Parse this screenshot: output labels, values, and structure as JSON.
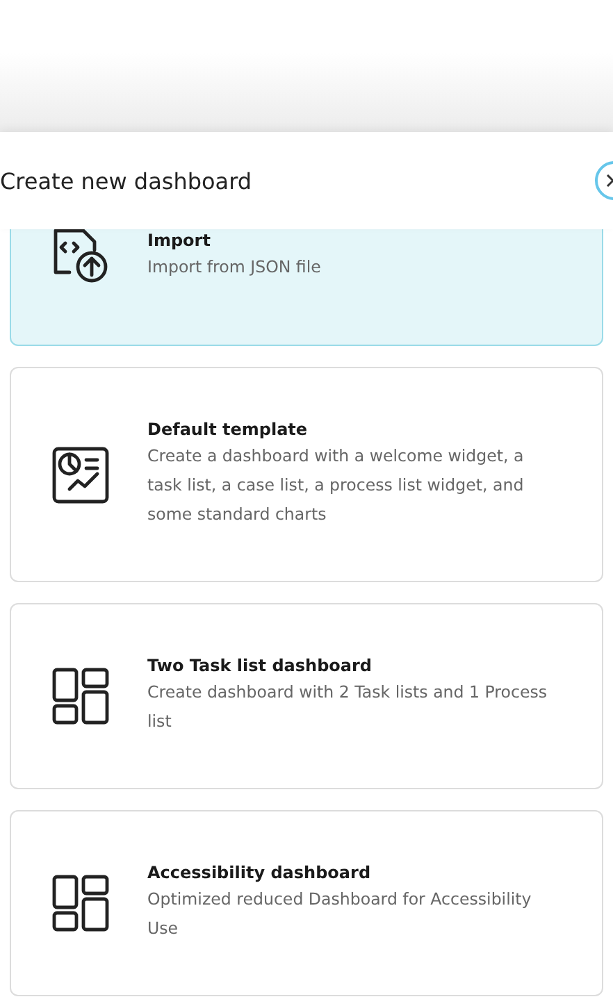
{
  "dialog": {
    "title": "Create new dashboard"
  },
  "templates": [
    {
      "kind": "import",
      "title": "Import",
      "description": "Import from JSON file",
      "selected": true
    },
    {
      "kind": "chart",
      "title": "Default template",
      "description": "Create a dashboard with a welcome widget, a task list, a case list, a process list widget, and some standard charts",
      "selected": false
    },
    {
      "kind": "layout",
      "title": "Two Task list dashboard",
      "description": "Create dashboard with 2 Task lists and 1 Process list",
      "selected": false
    },
    {
      "kind": "layout",
      "title": "Accessibility dashboard",
      "description": "Optimized reduced Dashboard for Accessibility Use",
      "selected": false
    }
  ]
}
